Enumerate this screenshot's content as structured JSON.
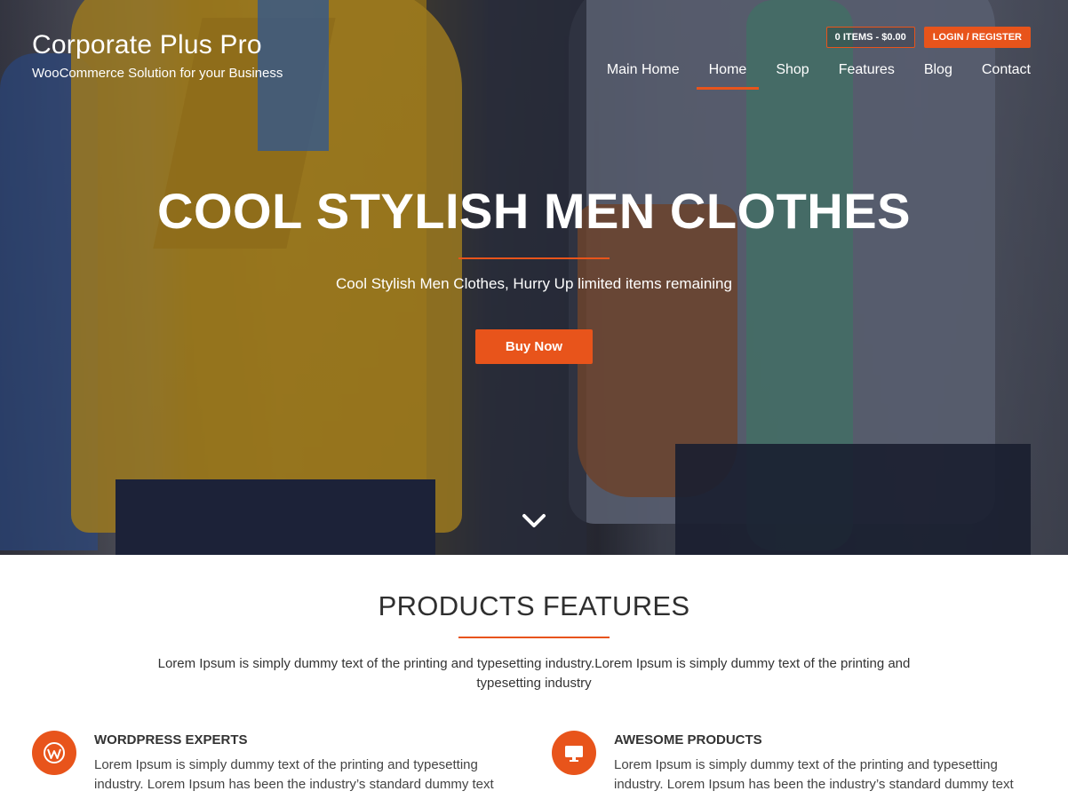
{
  "header": {
    "site_title": "Corporate Plus Pro",
    "tagline": "WooCommerce Solution for your Business",
    "cart_label": "0 ITEMS - $0.00",
    "login_label": "LOGIN / REGISTER",
    "nav": [
      {
        "label": "Main Home"
      },
      {
        "label": "Home",
        "active": true
      },
      {
        "label": "Shop"
      },
      {
        "label": "Features"
      },
      {
        "label": "Blog"
      },
      {
        "label": "Contact"
      }
    ]
  },
  "hero": {
    "title": "COOL STYLISH MEN CLOTHES",
    "subtitle": "Cool Stylish Men Clothes, Hurry Up limited items remaining",
    "button_label": "Buy Now",
    "scroll_icon": "chevron-down-icon"
  },
  "features": {
    "title": "PRODUCTS FEATURES",
    "description": "Lorem Ipsum is simply dummy text of the printing and typesetting industry.Lorem Ipsum is simply dummy text of the printing and typesetting industry",
    "items": [
      {
        "icon": "wordpress-icon",
        "title": "WORDPRESS EXPERTS",
        "text": "Lorem Ipsum is simply dummy text of the printing and typesetting industry. Lorem Ipsum has been the industry’s standard dummy text"
      },
      {
        "icon": "monitor-icon",
        "title": "AWESOME PRODUCTS",
        "text": "Lorem Ipsum is simply dummy text of the printing and typesetting industry. Lorem Ipsum has been the industry’s standard dummy text"
      }
    ]
  },
  "colors": {
    "accent": "#e8541b",
    "heading": "#2f2f2f"
  }
}
